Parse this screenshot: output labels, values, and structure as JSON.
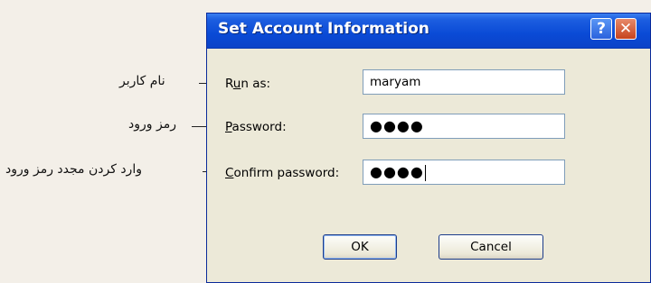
{
  "callouts": {
    "run_as": "نام کاربر",
    "password": "رمز ورود",
    "confirm": "وارد کردن مجدد رمز ورود"
  },
  "dialog": {
    "title": "Set Account Information",
    "help_glyph": "?",
    "close_glyph": "✕",
    "run_as": {
      "label_prefix": "R",
      "label_accel": "u",
      "label_suffix": "n as:",
      "value": "maryam"
    },
    "password": {
      "label_accel": "P",
      "label_suffix": "assword:",
      "value": "●●●●"
    },
    "confirm": {
      "label_accel": "C",
      "label_suffix": "onfirm password:",
      "value": "●●●●"
    },
    "ok_label": "OK",
    "cancel_label": "Cancel"
  },
  "colors": {
    "titlebar": "#0a4ad6",
    "close_button": "#c6431e",
    "dialog_bg": "#ece9d8"
  }
}
